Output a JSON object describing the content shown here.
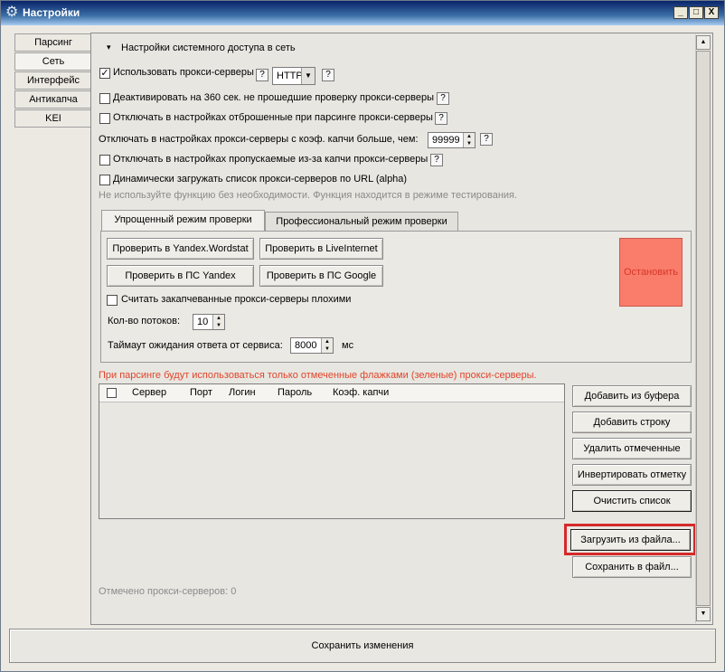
{
  "window": {
    "title": "Настройки",
    "minimize": "_",
    "maximize": "□",
    "close": "X"
  },
  "left_tabs": [
    "Парсинг",
    "Сеть",
    "Интерфейс",
    "Антикапча",
    "KEI"
  ],
  "section": {
    "title": "Настройки системного доступа в сеть",
    "toggle": "▾"
  },
  "options": {
    "use_proxy": {
      "label": "Использовать прокси-серверы",
      "checked": "✓",
      "protocol": "HTTP",
      "protocol_arrow": "▼"
    },
    "deactivate_360": {
      "label": "Деактивировать на 360 сек. не прошедшие проверку прокси-серверы"
    },
    "disable_rejected": {
      "label": "Отключать в настройках отброшенные при парсинге прокси-серверы"
    },
    "captcha_ratio": {
      "label": "Отключать в настройках прокси-серверы с коэф. капчи больше, чем:",
      "value": "99999"
    },
    "disable_skipped": {
      "label": "Отключать в настройках пропускаемые из-за капчи прокси-серверы"
    },
    "dynamic_load": {
      "label": "Динамически загружать список прокси-серверов по URL (alpha)",
      "note": "Не используйте функцию без необходимости. Функция находится в режиме тестирования."
    },
    "help": "?"
  },
  "check_tabs": [
    "Упрощенный режим проверки",
    "Профессиональный режим проверки"
  ],
  "check_buttons": {
    "yandex_wordstat": "Проверить в Yandex.Wordstat",
    "liveinternet": "Проверить в LiveInternet",
    "ps_yandex": "Проверить в ПС Yandex",
    "ps_google": "Проверить в ПС Google",
    "stop": "Остановить"
  },
  "captcha_bad": {
    "label": "Считать закапчеванные прокси-серверы плохими"
  },
  "threads": {
    "label": "Кол-во потоков:",
    "value": "10"
  },
  "timeout": {
    "label": "Таймаут ожидания ответа от сервиса:",
    "value": "8000",
    "unit": "мс"
  },
  "proxy_note": "При парсинге будут использоваться только отмеченные флажками (зеленые) прокси-серверы.",
  "table": {
    "columns": [
      "Сервер",
      "Порт",
      "Логин",
      "Пароль",
      "Коэф. капчи"
    ],
    "rows": []
  },
  "side_buttons": {
    "add_from_buffer": "Добавить из буфера",
    "add_row": "Добавить строку",
    "delete_marked": "Удалить отмеченные",
    "invert_mark": "Инвертировать отметку",
    "clear_list": "Очистить список",
    "load_from_file": "Загрузить из файла...",
    "save_to_file": "Сохранить в файл..."
  },
  "proxy_count": "Отмечено прокси-серверов: 0",
  "save_changes": "Сохранить изменения",
  "colors": {
    "highlight": "#d42a2a",
    "stop_button": "#fa7c6a",
    "note": "#e0452a"
  }
}
